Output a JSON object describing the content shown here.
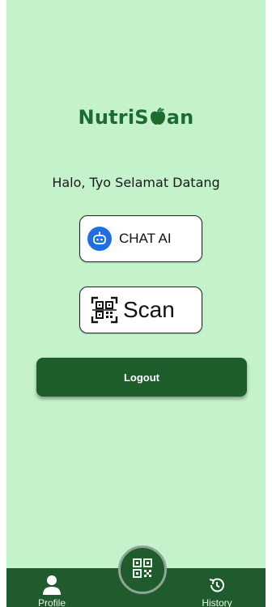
{
  "app": {
    "logo_text_before": "NutriS",
    "logo_text_after": "an",
    "greeting": "Halo, Tyo Selamat Datang"
  },
  "actions": {
    "chat_label": "CHAT AI",
    "scan_label": "Scan",
    "logout_label": "Logout"
  },
  "bottom_nav": {
    "items": [
      {
        "label": "Profile",
        "icon": "person-icon"
      },
      {
        "label": "History",
        "icon": "history-icon"
      }
    ],
    "center_icon": "qr-code-icon"
  },
  "colors": {
    "background": "#c4f2cb",
    "brand_green": "#1e6b32",
    "nav_green": "#1f5b2c",
    "chat_icon_blue": "#1f6fe0"
  }
}
